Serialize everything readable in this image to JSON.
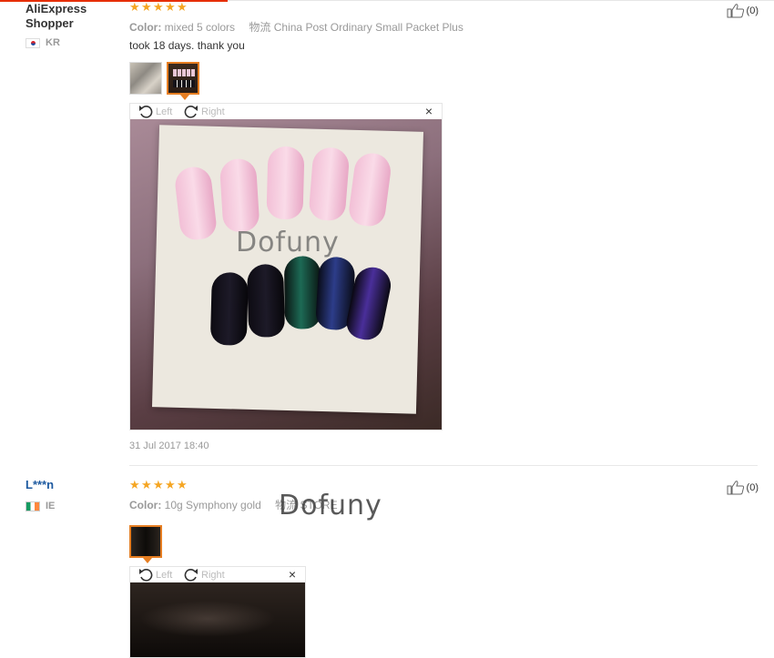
{
  "reviews": [
    {
      "user": "AliExpress Shopper",
      "user_line1": "AliExpress",
      "user_line2": "Shopper",
      "country_code": "KR",
      "rating": 5,
      "color_label": "Color:",
      "color_value": "mixed 5 colors",
      "shipping_label": "物流",
      "shipping_value": "China Post Ordinary Small Packet Plus",
      "text": "took 18 days. thank you",
      "viewer": {
        "left_label": "Left",
        "right_label": "Right",
        "close": "×"
      },
      "watermark": "Dofuny",
      "date": "31 Jul 2017 18:40",
      "helpful": "(0)"
    },
    {
      "user": "L***n",
      "country_code": "IE",
      "rating": 5,
      "color_label": "Color:",
      "color_value": "10g Symphony gold",
      "shipping_label": "物流",
      "shipping_value": "STORE",
      "viewer": {
        "left_label": "Left",
        "right_label": "Right",
        "close": "×"
      },
      "watermark": "Dofuny",
      "helpful": "(0)"
    }
  ],
  "icons": {
    "star": "star-icon",
    "thumbs_up": "thumbs-up-icon",
    "rotate_left": "rotate-left-icon",
    "rotate_right": "rotate-right-icon",
    "close": "close-icon"
  },
  "colors": {
    "accent": "#e62e04",
    "star": "#f5a623",
    "username_link": "#1e5aa0",
    "thumb_active": "#e67e22"
  }
}
